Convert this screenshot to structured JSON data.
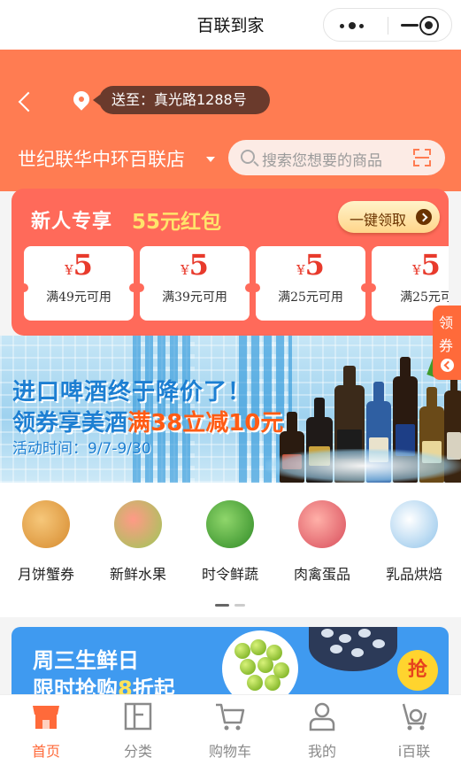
{
  "window": {
    "title": "百联到家"
  },
  "header": {
    "address_label": "送至：真光路1288号",
    "store_name": "世纪联华中环百联店",
    "search_placeholder": "搜索您想要的商品"
  },
  "coupon_card": {
    "title": "新人专享",
    "amount_label": "55元红包",
    "claim_button": "一键领取",
    "currency": "¥",
    "tickets": [
      {
        "value": "5",
        "condition": "满49元可用"
      },
      {
        "value": "5",
        "condition": "满39元可用"
      },
      {
        "value": "5",
        "condition": "满25元可用"
      },
      {
        "value": "5",
        "condition": "满25元可"
      }
    ]
  },
  "side_tab": {
    "line1": "领",
    "line2": "券"
  },
  "banner": {
    "line1": "进口啤酒终于降价了！",
    "line2_prefix": "领券享美酒",
    "line2_highlight": "满38立减10元",
    "line3": "活动时间：9/7-9/30"
  },
  "categories": [
    {
      "name": "月饼蟹券",
      "icon": "mooncake-icon",
      "color": "#e39a3c"
    },
    {
      "name": "新鲜水果",
      "icon": "fruit-icon",
      "color": "#f08a7a"
    },
    {
      "name": "时令鲜蔬",
      "icon": "vegetable-icon",
      "color": "#4fae3a"
    },
    {
      "name": "肉禽蛋品",
      "icon": "meat-icon",
      "color": "#e56a72"
    },
    {
      "name": "乳品烘焙",
      "icon": "dairy-icon",
      "color": "#7ab7e8"
    }
  ],
  "promo": {
    "line1": "周三生鲜日",
    "line2_prefix": "限时抢购",
    "line2_highlight": "8",
    "line2_suffix": "折起",
    "grab_label": "抢"
  },
  "tabbar": [
    {
      "label": "首页",
      "icon": "home-store-icon",
      "active": true
    },
    {
      "label": "分类",
      "icon": "category-icon",
      "active": false
    },
    {
      "label": "购物车",
      "icon": "cart-icon",
      "active": false
    },
    {
      "label": "我的",
      "icon": "profile-icon",
      "active": false
    },
    {
      "label": "i百联",
      "icon": "ibailian-icon",
      "active": false
    }
  ],
  "colors": {
    "brand_orange": "#ff7c52",
    "coupon_red": "#ff6a5a",
    "active_tab": "#ff6a3a"
  }
}
